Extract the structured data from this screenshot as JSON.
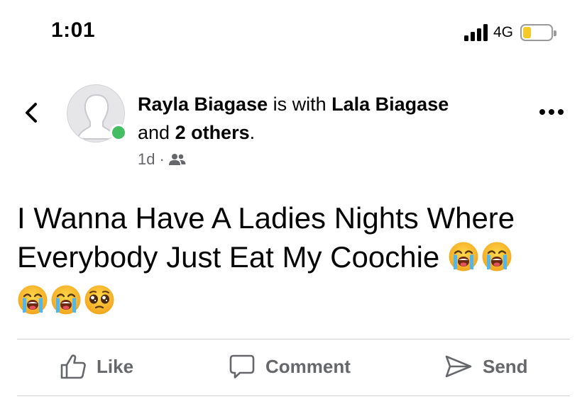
{
  "status_bar": {
    "time": "1:01",
    "network": "4G",
    "battery_level": 0.3,
    "battery_color": "#f5c928"
  },
  "header": {
    "back_icon": "chevron-left-icon",
    "author": "Rayla Biagase",
    "with_text": " is with ",
    "tagged": "Lala Biagase",
    "and_text": "and ",
    "others": "2 others",
    "period": ".",
    "time_ago": "1d",
    "separator": "·",
    "audience_icon": "friends-icon",
    "online_color": "#45bd62",
    "more_icon": "more-horizontal-icon"
  },
  "post": {
    "line1": "I Wanna Have A Ladies Nights Where",
    "line2": "Everybody Just Eat My Coochie",
    "emojis": [
      "loudly-crying-face",
      "loudly-crying-face",
      "loudly-crying-face",
      "loudly-crying-face",
      "pleading-face"
    ]
  },
  "actions": {
    "like": "Like",
    "comment": "Comment",
    "send": "Send"
  }
}
